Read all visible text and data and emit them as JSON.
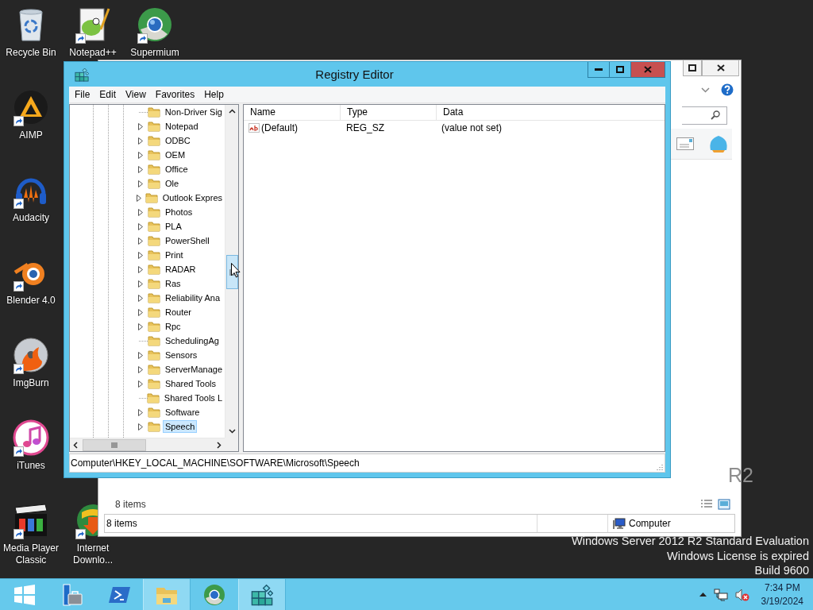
{
  "desktop": {
    "icons": [
      {
        "label": "Recycle Bin",
        "kind": "recycle-bin",
        "shortcut": false
      },
      {
        "label": "Notepad++",
        "kind": "notepad",
        "shortcut": true
      },
      {
        "label": "Supermium",
        "kind": "browser",
        "shortcut": true
      },
      {
        "label": "AIMP",
        "kind": "aimp",
        "shortcut": true
      },
      {
        "label": "Audacity",
        "kind": "audacity",
        "shortcut": true
      },
      {
        "label": "Blender 4.0",
        "kind": "blender",
        "shortcut": true
      },
      {
        "label": "ImgBurn",
        "kind": "imgburn",
        "shortcut": true
      },
      {
        "label": "iTunes",
        "kind": "itunes",
        "shortcut": true
      },
      {
        "label": "Media Player Classic",
        "kind": "media-player",
        "shortcut": true
      },
      {
        "label": "Internet Downlo...",
        "kind": "downloader",
        "shortcut": true
      }
    ],
    "logo_fragment": "R2",
    "watermark": [
      "Windows Server 2012 R2 Standard Evaluation",
      "Windows License is expired",
      "Build 9600"
    ]
  },
  "explorer_window": {
    "items_count": "8 items",
    "status_bar": {
      "items": "8 items",
      "location": "Computer"
    }
  },
  "registry_editor": {
    "title": "Registry Editor",
    "menu": [
      "File",
      "Edit",
      "View",
      "Favorites",
      "Help"
    ],
    "tree": {
      "items": [
        {
          "label": "Non-Driver Sig",
          "expandable": false,
          "selected": false
        },
        {
          "label": "Notepad",
          "expandable": true,
          "selected": false
        },
        {
          "label": "ODBC",
          "expandable": true,
          "selected": false
        },
        {
          "label": "OEM",
          "expandable": true,
          "selected": false
        },
        {
          "label": "Office",
          "expandable": true,
          "selected": false
        },
        {
          "label": "Ole",
          "expandable": true,
          "selected": false
        },
        {
          "label": "Outlook Expres",
          "expandable": true,
          "selected": false
        },
        {
          "label": "Photos",
          "expandable": true,
          "selected": false
        },
        {
          "label": "PLA",
          "expandable": true,
          "selected": false
        },
        {
          "label": "PowerShell",
          "expandable": true,
          "selected": false
        },
        {
          "label": "Print",
          "expandable": true,
          "selected": false
        },
        {
          "label": "RADAR",
          "expandable": true,
          "selected": false
        },
        {
          "label": "Ras",
          "expandable": true,
          "selected": false
        },
        {
          "label": "Reliability Ana",
          "expandable": true,
          "selected": false
        },
        {
          "label": "Router",
          "expandable": true,
          "selected": false
        },
        {
          "label": "Rpc",
          "expandable": true,
          "selected": false
        },
        {
          "label": "SchedulingAg",
          "expandable": false,
          "selected": false
        },
        {
          "label": "Sensors",
          "expandable": true,
          "selected": false
        },
        {
          "label": "ServerManage",
          "expandable": true,
          "selected": false
        },
        {
          "label": "Shared Tools",
          "expandable": true,
          "selected": false
        },
        {
          "label": "Shared Tools L",
          "expandable": false,
          "selected": false
        },
        {
          "label": "Software",
          "expandable": true,
          "selected": false
        },
        {
          "label": "Speech",
          "expandable": true,
          "selected": true
        }
      ]
    },
    "values": {
      "columns": [
        "Name",
        "Type",
        "Data"
      ],
      "rows": [
        {
          "name": "(Default)",
          "type": "REG_SZ",
          "data": "(value not set)"
        }
      ]
    },
    "address": "Computer\\HKEY_LOCAL_MACHINE\\SOFTWARE\\Microsoft\\Speech"
  },
  "taskbar": {
    "items": [
      {
        "kind": "start",
        "active": false
      },
      {
        "kind": "server-manager",
        "active": false
      },
      {
        "kind": "powershell",
        "active": false
      },
      {
        "kind": "file-explorer",
        "active": true
      },
      {
        "kind": "browser",
        "active": false
      },
      {
        "kind": "registry-editor",
        "active": true
      }
    ],
    "clock": {
      "time": "7:34 PM",
      "date": "3/19/2024"
    }
  }
}
